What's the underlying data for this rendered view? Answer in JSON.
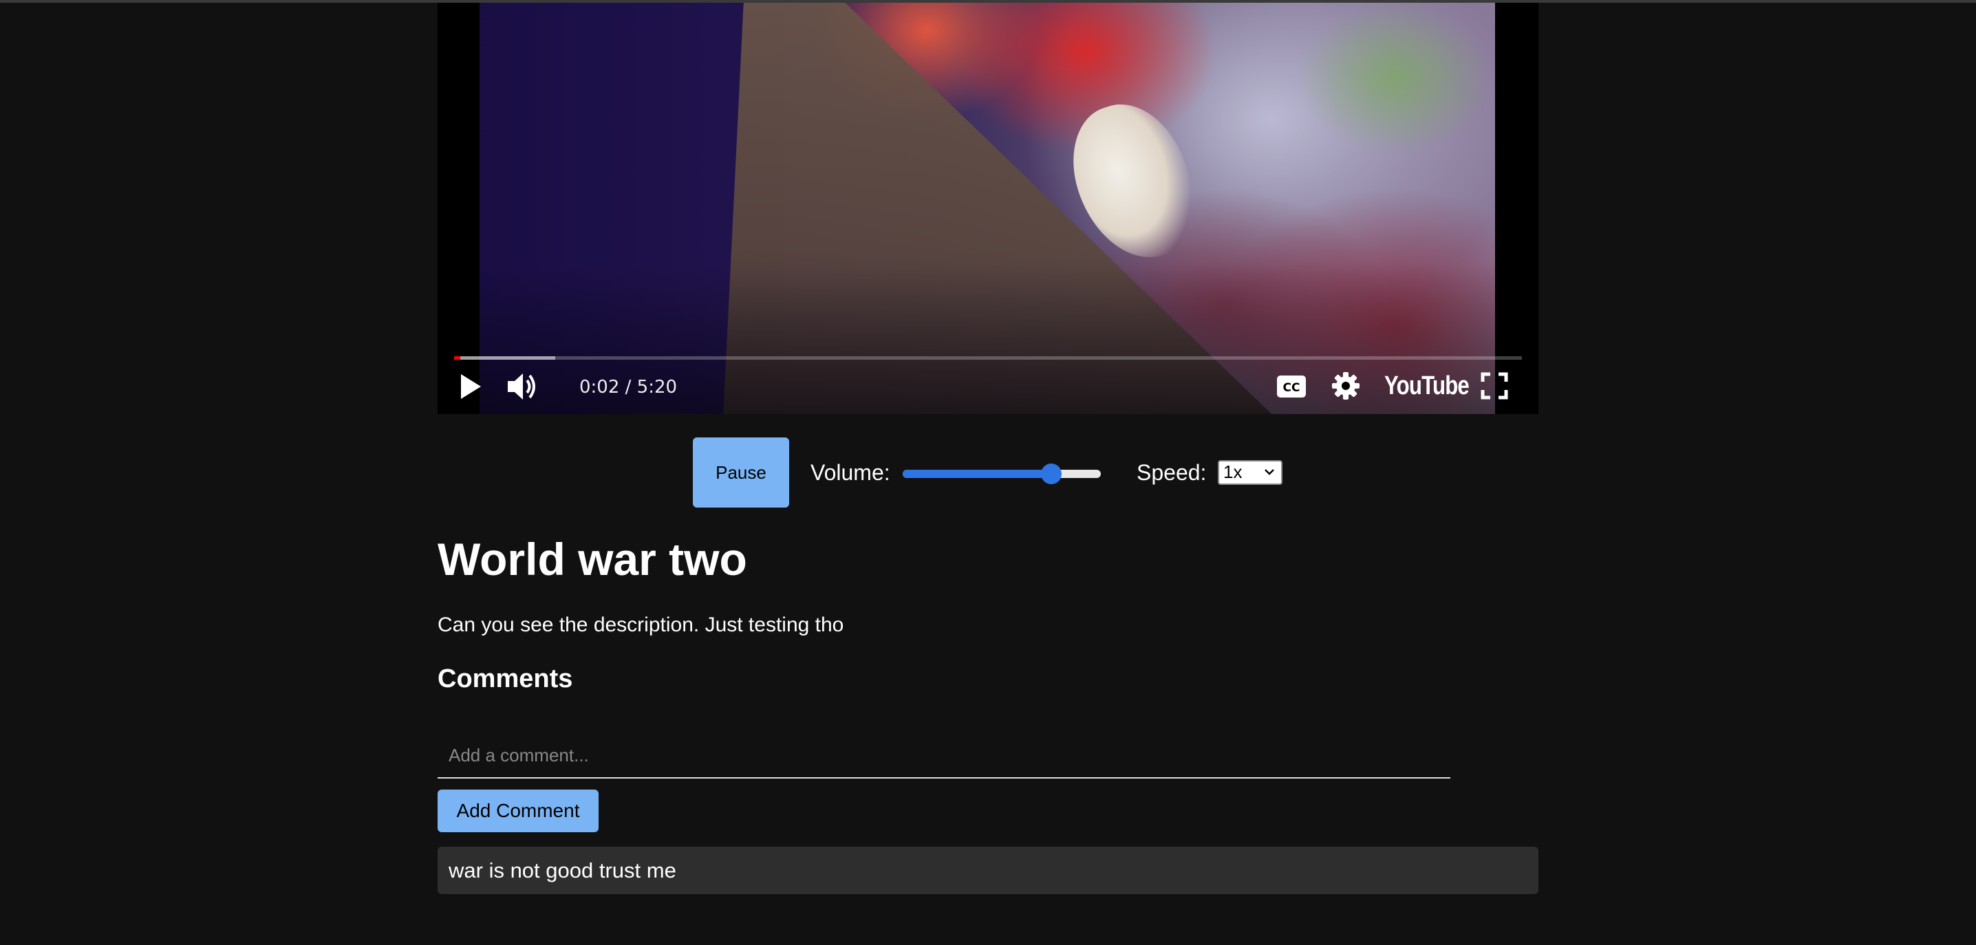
{
  "player": {
    "time_display": "0:02 / 5:20",
    "progress_played": 0.006,
    "progress_buffered": 0.095,
    "brand": "YouTube",
    "icons": [
      "play-icon",
      "volume-icon",
      "captions-icon",
      "settings-icon",
      "youtube-logo",
      "fullscreen-icon"
    ]
  },
  "controls": {
    "pause_label": "Pause",
    "volume_label": "Volume:",
    "volume_value": 0.75,
    "speed_label": "Speed:",
    "speed_value": "1x"
  },
  "video": {
    "title": "World war two",
    "description": "Can you see the description. Just testing tho"
  },
  "comments": {
    "heading": "Comments",
    "placeholder": "Add a comment...",
    "add_label": "Add Comment",
    "items": [
      {
        "text": "war is not good trust me"
      }
    ]
  },
  "colors": {
    "background": "#111111",
    "button": "#7ab4f5",
    "slider": "#2f74e3",
    "progress": "#ff0000",
    "comment_bg": "#2e2e2e"
  }
}
